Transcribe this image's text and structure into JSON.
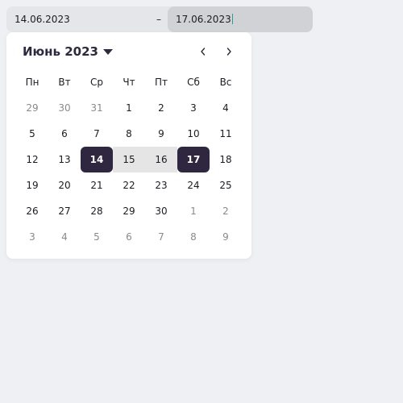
{
  "date_range": {
    "start_value": "14.06.2023",
    "separator": "–",
    "end_value": "17.06.2023"
  },
  "calendar": {
    "month_title": "Июнь 2023",
    "weekdays": [
      "Пн",
      "Вт",
      "Ср",
      "Чт",
      "Пт",
      "Сб",
      "Вс"
    ],
    "weeks": [
      [
        {
          "label": "29",
          "state": "muted"
        },
        {
          "label": "30",
          "state": "muted"
        },
        {
          "label": "31",
          "state": "muted"
        },
        {
          "label": "1",
          "state": "normal"
        },
        {
          "label": "2",
          "state": "normal"
        },
        {
          "label": "3",
          "state": "normal"
        },
        {
          "label": "4",
          "state": "normal"
        }
      ],
      [
        {
          "label": "5",
          "state": "normal"
        },
        {
          "label": "6",
          "state": "normal"
        },
        {
          "label": "7",
          "state": "normal"
        },
        {
          "label": "8",
          "state": "normal"
        },
        {
          "label": "9",
          "state": "normal"
        },
        {
          "label": "10",
          "state": "normal"
        },
        {
          "label": "11",
          "state": "normal"
        }
      ],
      [
        {
          "label": "12",
          "state": "normal"
        },
        {
          "label": "13",
          "state": "normal"
        },
        {
          "label": "14",
          "state": "selected"
        },
        {
          "label": "15",
          "state": "in-range"
        },
        {
          "label": "16",
          "state": "in-range"
        },
        {
          "label": "17",
          "state": "selected"
        },
        {
          "label": "18",
          "state": "normal"
        }
      ],
      [
        {
          "label": "19",
          "state": "normal"
        },
        {
          "label": "20",
          "state": "normal"
        },
        {
          "label": "21",
          "state": "normal"
        },
        {
          "label": "22",
          "state": "normal"
        },
        {
          "label": "23",
          "state": "normal"
        },
        {
          "label": "24",
          "state": "normal"
        },
        {
          "label": "25",
          "state": "normal"
        }
      ],
      [
        {
          "label": "26",
          "state": "normal"
        },
        {
          "label": "27",
          "state": "normal"
        },
        {
          "label": "28",
          "state": "normal"
        },
        {
          "label": "29",
          "state": "normal"
        },
        {
          "label": "30",
          "state": "normal"
        },
        {
          "label": "1",
          "state": "muted"
        },
        {
          "label": "2",
          "state": "muted"
        }
      ],
      [
        {
          "label": "3",
          "state": "muted"
        },
        {
          "label": "4",
          "state": "muted"
        },
        {
          "label": "5",
          "state": "muted"
        },
        {
          "label": "6",
          "state": "muted"
        },
        {
          "label": "7",
          "state": "muted"
        },
        {
          "label": "8",
          "state": "muted"
        },
        {
          "label": "9",
          "state": "muted"
        }
      ]
    ],
    "icons": {
      "month_dropdown": "caret-down-icon",
      "prev": "chevron-left-icon",
      "next": "chevron-right-icon"
    }
  },
  "colors": {
    "page_background": "#eff0f3",
    "selected_day": "#2f2640",
    "range_fill": "#e5e5e5",
    "active_input": "#d1d2d6"
  }
}
